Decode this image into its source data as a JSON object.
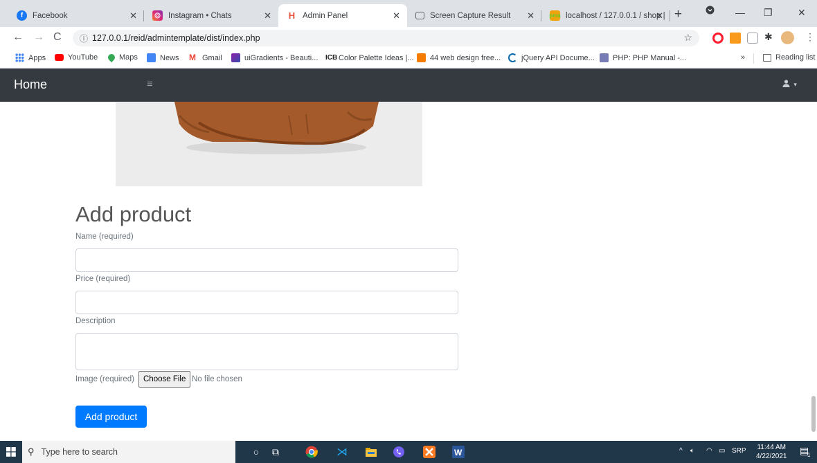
{
  "browser": {
    "tabs": [
      {
        "title": "Facebook",
        "icon": "facebook-icon",
        "active": false
      },
      {
        "title": "Instagram • Chats",
        "icon": "instagram-icon",
        "active": false
      },
      {
        "title": "Admin Panel",
        "icon": "admin-panel-icon",
        "active": true
      },
      {
        "title": "Screen Capture Result",
        "icon": "camera-icon",
        "active": false
      },
      {
        "title": "localhost / 127.0.0.1 / shop | ",
        "icon": "phpmyadmin-icon",
        "active": false
      }
    ],
    "url": "127.0.0.1/reid/admintemplate/dist/index.php",
    "bookmarks": [
      {
        "label": "Apps",
        "icon": "apps-grid-icon",
        "color": "#1a73e8"
      },
      {
        "label": "YouTube",
        "icon": "youtube-icon",
        "color": "#ff0000"
      },
      {
        "label": "Maps",
        "icon": "maps-icon",
        "color": "#34a853"
      },
      {
        "label": "News",
        "icon": "news-icon",
        "color": "#4285f4"
      },
      {
        "label": "Gmail",
        "icon": "gmail-icon",
        "color": "#ea4335"
      },
      {
        "label": "uiGradients - Beauti...",
        "icon": "uigradients-icon",
        "color": "#8e24aa"
      },
      {
        "label": "Color Palette Ideas |...",
        "icon": "colorpalette-icon",
        "color": "#222222"
      },
      {
        "label": "44 web design free...",
        "icon": "webdesign-icon",
        "color": "#f57c00"
      },
      {
        "label": "jQuery API Docume...",
        "icon": "jquery-icon",
        "color": "#0769ad"
      },
      {
        "label": "PHP: PHP Manual -...",
        "icon": "php-icon",
        "color": "#777bb3"
      }
    ],
    "bookmarks_more": "»",
    "reading_list": "Reading list"
  },
  "admin_nav": {
    "brand": "Home",
    "toggler": "≡",
    "user_caret": "▾"
  },
  "form": {
    "heading": "Add product",
    "name_label": "Name (required)",
    "name_value": "",
    "price_label": "Price (required)",
    "price_value": "",
    "description_label": "Description",
    "description_value": "",
    "image_label": "Image (required)",
    "choose_file": "Choose File",
    "no_file": "No file chosen",
    "submit": "Add product"
  },
  "taskbar": {
    "search_placeholder": "Type here to search",
    "tray_language": "SRP",
    "time": "11:44 AM",
    "date": "4/22/2021",
    "notification_count": "1"
  },
  "colors": {
    "primary": "#007bff",
    "nav_bg": "#343a40",
    "taskbar_bg": "#203649",
    "sweater": "#a45a2a"
  }
}
